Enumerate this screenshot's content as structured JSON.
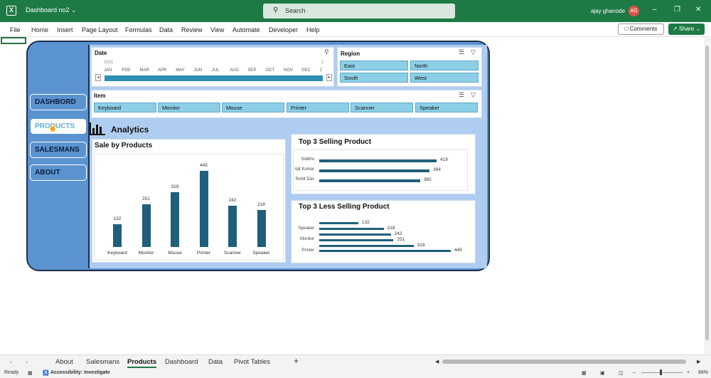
{
  "window": {
    "doc_title": "Dashboard no2 ⌄",
    "search_placeholder": "Search",
    "user_name": "ajay ghanode",
    "user_initials": "AG"
  },
  "menu": [
    "File",
    "Home",
    "Insert",
    "Page Layout",
    "Formulas",
    "Data",
    "Review",
    "View",
    "Automate",
    "Developer",
    "Help"
  ],
  "toolbar": {
    "comments_label": "Comments",
    "share_label": "Share"
  },
  "nav": [
    "DASHBORD",
    "PRODUCTS",
    "SALESMANS",
    "ABOUT"
  ],
  "nav_active": "PRODUCTS",
  "date_slicer": {
    "title": "Date",
    "year_left": "2021",
    "year_right": "2",
    "months": [
      "JAN",
      "FEB",
      "MAR",
      "APR",
      "MAY",
      "JUN",
      "JUL",
      "AUG",
      "SEP",
      "OCT",
      "NOV",
      "DEC",
      "J"
    ]
  },
  "region_slicer": {
    "title": "Region",
    "items": [
      "East",
      "North",
      "South",
      "West"
    ]
  },
  "item_slicer": {
    "title": "Item",
    "items": [
      "Keyboard",
      "Monitor",
      "Mouse",
      "Printer",
      "Scanner",
      "Speaker"
    ]
  },
  "analytics_label": "Analytics",
  "chart_data": [
    {
      "type": "bar",
      "title": "Sale by Products",
      "categories": [
        "Keyboard",
        "Monitor",
        "Mouse",
        "Printer",
        "Scanner",
        "Speaker"
      ],
      "values": [
        132,
        251,
        319,
        445,
        242,
        218
      ],
      "ylim": [
        0,
        445
      ],
      "color": "#1f5f7a"
    },
    {
      "type": "bar",
      "orientation": "horizontal",
      "title": "Top 3 Selling Product",
      "categories": [
        "Siddhu",
        "Ajit Kumar",
        "Rohit Das"
      ],
      "values": [
        419,
        394,
        360
      ],
      "xlim": [
        0,
        445
      ],
      "color": "#1f5f7a"
    },
    {
      "type": "bar",
      "orientation": "horizontal",
      "title": "Top 3 Less Selling Product",
      "categories": [
        "Speaker",
        "Monitor",
        "Printer"
      ],
      "values": [
        132,
        218,
        242,
        251,
        319,
        445
      ],
      "xlim": [
        0,
        445
      ],
      "color": "#1f5f7a"
    }
  ],
  "sheet_tabs": [
    "About",
    "Salesmans",
    "Products",
    "Dashboard",
    "Data",
    "Pivot Tables"
  ],
  "active_tab": "Products",
  "status": {
    "ready": "Ready",
    "accessibility": "Accessibility: Investigate",
    "zoom": "88%"
  }
}
